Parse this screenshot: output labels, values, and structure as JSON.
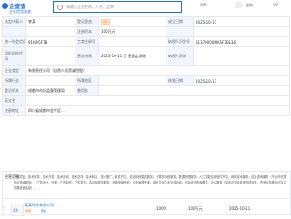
{
  "header": {
    "logo_name": "企查查",
    "logo_sub": "企业信用查询",
    "search_placeholder": "请输入企业名称、人名、品牌",
    "nav": [
      "APP",
      "服务",
      "VIP"
    ]
  },
  "info_rows": [
    [
      "法定代表人",
      "李某",
      "登记状态",
      "存续",
      "成立日期",
      "2025-10-11"
    ],
    [
      "",
      "",
      "注册资本",
      "100万元",
      "",
      ""
    ],
    [
      "统一社会信用代码",
      "91MA5F7B",
      "工商注册号",
      "",
      "纳税人识别号",
      "91370000MA5F7BL36"
    ],
    [
      "组织机构代码",
      "",
      "营业期限",
      "2025-10-11 至 无固定期限",
      "纳税人资质",
      ""
    ],
    [
      "企业类型",
      "有限责任公司（自然人投资或控股）",
      "",
      "",
      "",
      ""
    ],
    [
      "所属行业",
      "",
      "所属地区",
      "",
      "核准日期",
      "2025-10-11"
    ],
    [
      "登记机关",
      "成都市市场监督管理局",
      "曾用名",
      "",
      "",
      ""
    ],
    [
      "英文名",
      "",
      "",
      "",
      "",
      ""
    ],
    [
      "注册地址",
      "四川省成都市金牛区...",
      "",
      "",
      "",
      ""
    ]
  ],
  "scope": {
    "label": "经营范围",
    "text": "一般项目：技术服务、技术开发、技术咨询、技术交流、技术转让、技术推广；软件开发；信息系统集成服务；计算机系统服务；数据处理服务；人工智能应用软件开发；网络技术服务；信息咨询服务（不含许可类信息咨询服务）；广告设计、代理；广告制作；广告发布；会议及展览服务；市场营销策划；企业管理咨询；组织文化艺术交流活动；社会经济咨询服务；办公服务（除依法须经批准的项目外，凭营业执照依法自主开展经营活动）。"
  },
  "bottom": {
    "index": "1",
    "avatar_text": "企业",
    "name": "某某科技有限公司",
    "tag": "存续",
    "tag2": "查看",
    "cols": [
      "100%",
      "100万元",
      "2025-10-11"
    ]
  }
}
